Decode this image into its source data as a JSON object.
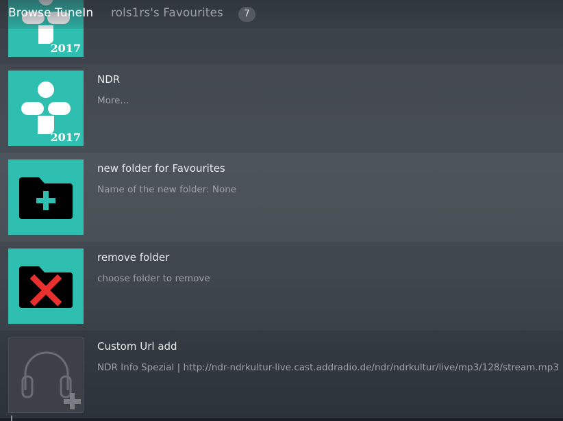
{
  "header": {
    "brand": "Browse TuneIn",
    "breadcrumb": "rols1rs's Favourites",
    "count": "7"
  },
  "colors": {
    "tile_teal": "#2ebfb0",
    "tile_dark": "#3d4147",
    "delete_red": "#e8302e",
    "add_teal": "#2ebfb0"
  },
  "items": [
    {
      "title": "",
      "subtitle": "",
      "year": "2017",
      "icon": "tunein-logo-icon"
    },
    {
      "title": "NDR",
      "subtitle": "More...",
      "year": "2017",
      "icon": "tunein-logo-icon"
    },
    {
      "title": "new folder for Favourites",
      "subtitle": "Name of the new folder: None",
      "icon": "folder-add-icon"
    },
    {
      "title": "remove folder",
      "subtitle": "choose folder to remove",
      "icon": "folder-remove-icon"
    },
    {
      "title": "Custom Url add",
      "subtitle": "NDR Info Spezial | http://ndr-ndrkultur-live.cast.addradio.de/ndr/ndrkultur/live/mp3/128/stream.mp3",
      "icon": "headphones-add-icon"
    }
  ]
}
